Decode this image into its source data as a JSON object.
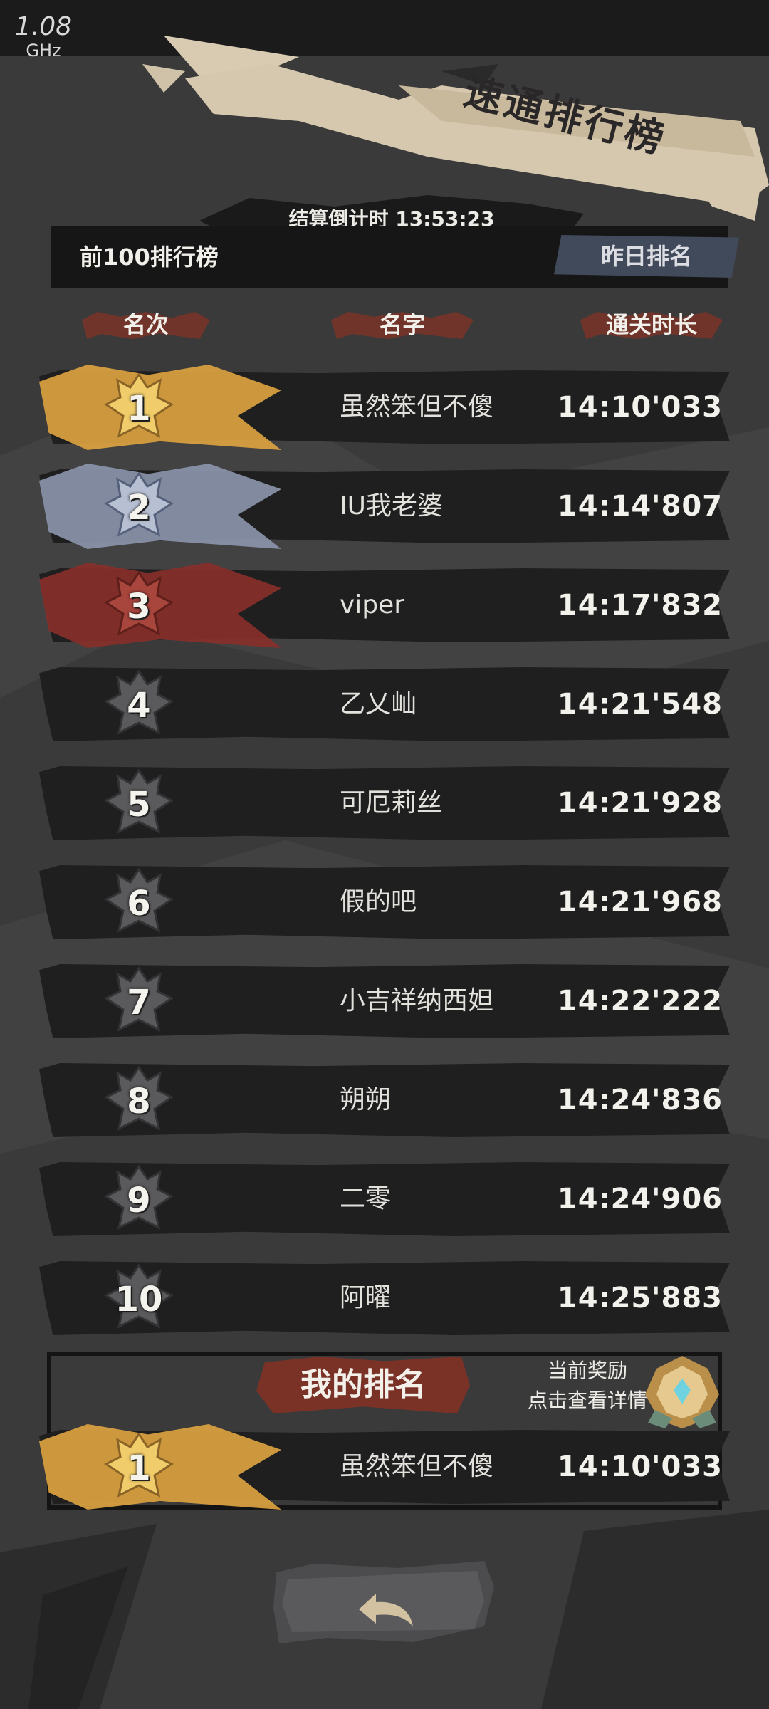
{
  "status": {
    "cpu_freq": "1.08",
    "cpu_unit": "GHz"
  },
  "title": "速通排行榜",
  "countdown": "结算倒计时 13:53:23",
  "leaderboard_label": "前100排行榜",
  "yesterday_button": "昨日排名",
  "headers": {
    "rank": "名次",
    "name": "名字",
    "time": "通关时长"
  },
  "rows": [
    {
      "rank": "1",
      "name": "虽然笨但不傻",
      "time": "14:10'033"
    },
    {
      "rank": "2",
      "name": "IU我老婆",
      "time": "14:14'807"
    },
    {
      "rank": "3",
      "name": "viper",
      "time": "14:17'832"
    },
    {
      "rank": "4",
      "name": "乙乂屾",
      "time": "14:21'548"
    },
    {
      "rank": "5",
      "name": "可厄莉丝",
      "time": "14:21'928"
    },
    {
      "rank": "6",
      "name": "假的吧",
      "time": "14:21'968"
    },
    {
      "rank": "7",
      "name": "小吉祥纳西妲",
      "time": "14:22'222"
    },
    {
      "rank": "8",
      "name": "朔朔",
      "time": "14:24'836"
    },
    {
      "rank": "9",
      "name": "二零",
      "time": "14:24'906"
    },
    {
      "rank": "10",
      "name": "阿曜",
      "time": "14:25'883"
    }
  ],
  "my_rank": {
    "label": "我的排名",
    "reward_line1": "当前奖励",
    "reward_line2": "点击查看详情",
    "rank": "1",
    "name": "虽然笨但不傻",
    "time": "14:10'033"
  },
  "colors": {
    "gold": "#e0a540",
    "silver": "#8d96ad",
    "bronze": "#8a2f2a",
    "accent_red": "#7a3428",
    "row_bg": "#1f1f20"
  }
}
